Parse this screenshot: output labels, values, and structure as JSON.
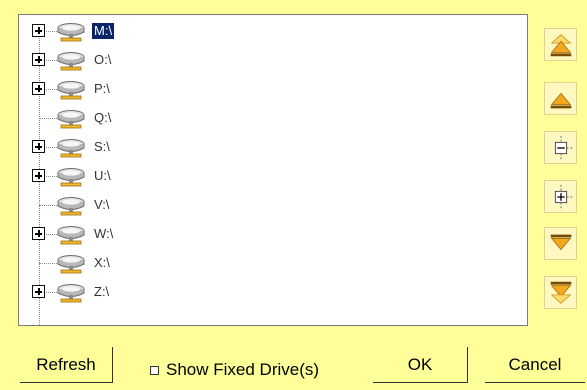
{
  "drives": [
    {
      "label": "M:\\",
      "expandable": true,
      "selected": true
    },
    {
      "label": "O:\\",
      "expandable": true,
      "selected": false
    },
    {
      "label": "P:\\",
      "expandable": true,
      "selected": false
    },
    {
      "label": "Q:\\",
      "expandable": false,
      "selected": false
    },
    {
      "label": "S:\\",
      "expandable": true,
      "selected": false
    },
    {
      "label": "U:\\",
      "expandable": true,
      "selected": false
    },
    {
      "label": "V:\\",
      "expandable": false,
      "selected": false
    },
    {
      "label": "W:\\",
      "expandable": true,
      "selected": false
    },
    {
      "label": "X:\\",
      "expandable": false,
      "selected": false
    },
    {
      "label": "Z:\\",
      "expandable": true,
      "selected": false
    }
  ],
  "side_buttons": [
    {
      "name": "move-top-button",
      "icon": "double-up-arrow-icon"
    },
    {
      "name": "move-up-button",
      "icon": "up-arrow-icon"
    },
    {
      "name": "collapse-all-button",
      "icon": "collapse-tree-icon"
    },
    {
      "name": "expand-all-button",
      "icon": "expand-tree-icon"
    },
    {
      "name": "move-down-button",
      "icon": "down-arrow-icon"
    },
    {
      "name": "move-bottom-button",
      "icon": "double-down-arrow-icon"
    }
  ],
  "buttons": {
    "refresh": "Refresh",
    "ok": "OK",
    "cancel": "Cancel"
  },
  "show_fixed": {
    "label": "Show Fixed Drive(s)",
    "checked": false
  },
  "colors": {
    "background": "#ffff99",
    "selection": "#0a246a",
    "arrow_fill": "#f4a81e",
    "arrow_light": "#ffd968"
  }
}
